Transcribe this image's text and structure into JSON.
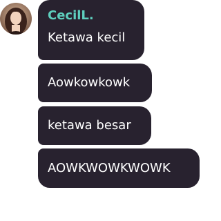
{
  "sender": {
    "name": "CecilL.",
    "name_color": "#5ecfbe"
  },
  "messages": [
    "Ketawa kecil",
    "Aowkowkowk",
    "ketawa besar",
    "AOWKWOWKWOWK"
  ],
  "colors": {
    "bubble": "#28222f",
    "text": "#ffffff"
  }
}
